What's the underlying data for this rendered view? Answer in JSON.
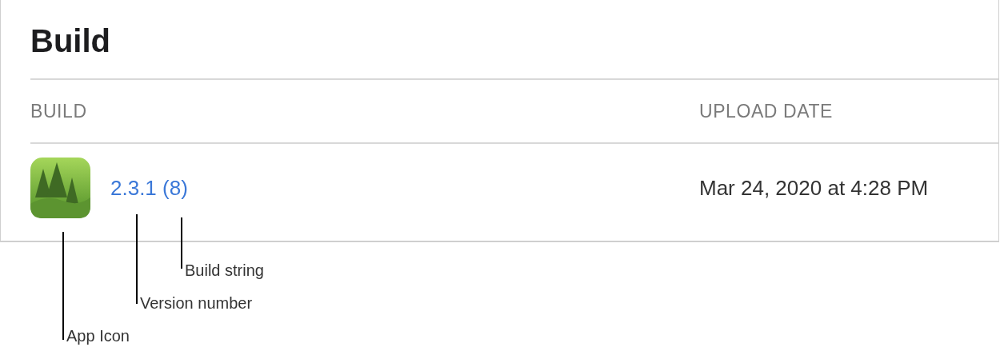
{
  "section": {
    "title": "Build"
  },
  "table": {
    "columns": [
      "BUILD",
      "UPLOAD DATE"
    ],
    "rows": [
      {
        "build": "2.3.1 (8)",
        "upload_date": "Mar 24, 2020 at 4:28 PM"
      }
    ]
  },
  "callouts": [
    {
      "label": "Build string"
    },
    {
      "label": "Version number"
    },
    {
      "label": "App Icon"
    }
  ]
}
